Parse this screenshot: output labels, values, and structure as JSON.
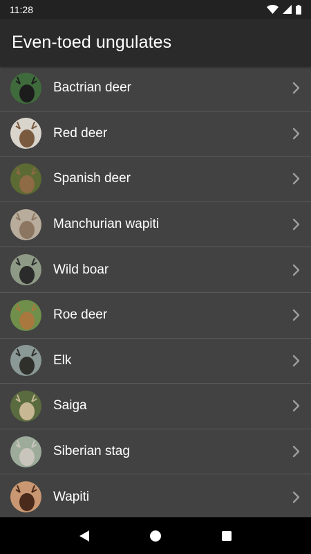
{
  "status": {
    "time": "11:28"
  },
  "appbar": {
    "title": "Even-toed ungulates"
  },
  "items": [
    {
      "label": "Bactrian deer",
      "icon": "bactrian-deer-avatar",
      "bg": "#3f6b3c",
      "fg": "#1c1c1c"
    },
    {
      "label": "Red deer",
      "icon": "red-deer-avatar",
      "bg": "#d9d4cc",
      "fg": "#7a5a3e"
    },
    {
      "label": "Spanish deer",
      "icon": "spanish-deer-avatar",
      "bg": "#5c6a33",
      "fg": "#8e6a45"
    },
    {
      "label": "Manchurian wapiti",
      "icon": "manchurian-wapiti-avatar",
      "bg": "#b8ad9c",
      "fg": "#8d7661"
    },
    {
      "label": "Wild boar",
      "icon": "wild-boar-avatar",
      "bg": "#8e9a86",
      "fg": "#2b2b2b"
    },
    {
      "label": "Roe deer",
      "icon": "roe-deer-avatar",
      "bg": "#6f8f4a",
      "fg": "#a9783f"
    },
    {
      "label": "Elk",
      "icon": "elk-avatar",
      "bg": "#8a9896",
      "fg": "#2f302c"
    },
    {
      "label": "Saiga",
      "icon": "saiga-avatar",
      "bg": "#5a6c3f",
      "fg": "#c7b793"
    },
    {
      "label": "Siberian stag",
      "icon": "siberian-stag-avatar",
      "bg": "#9cab9a",
      "fg": "#c9c5bd"
    },
    {
      "label": "Wapiti",
      "icon": "wapiti-avatar",
      "bg": "#c99872",
      "fg": "#4a2a1a"
    }
  ],
  "colors": {
    "appbar": "#2a2a2a",
    "list_bg": "#424242",
    "divider": "#5a5a5a",
    "text": "#ffffff",
    "chevron": "#9e9e9e"
  },
  "nav": {
    "back": "back-icon",
    "home": "home-icon",
    "recents": "recents-icon"
  }
}
